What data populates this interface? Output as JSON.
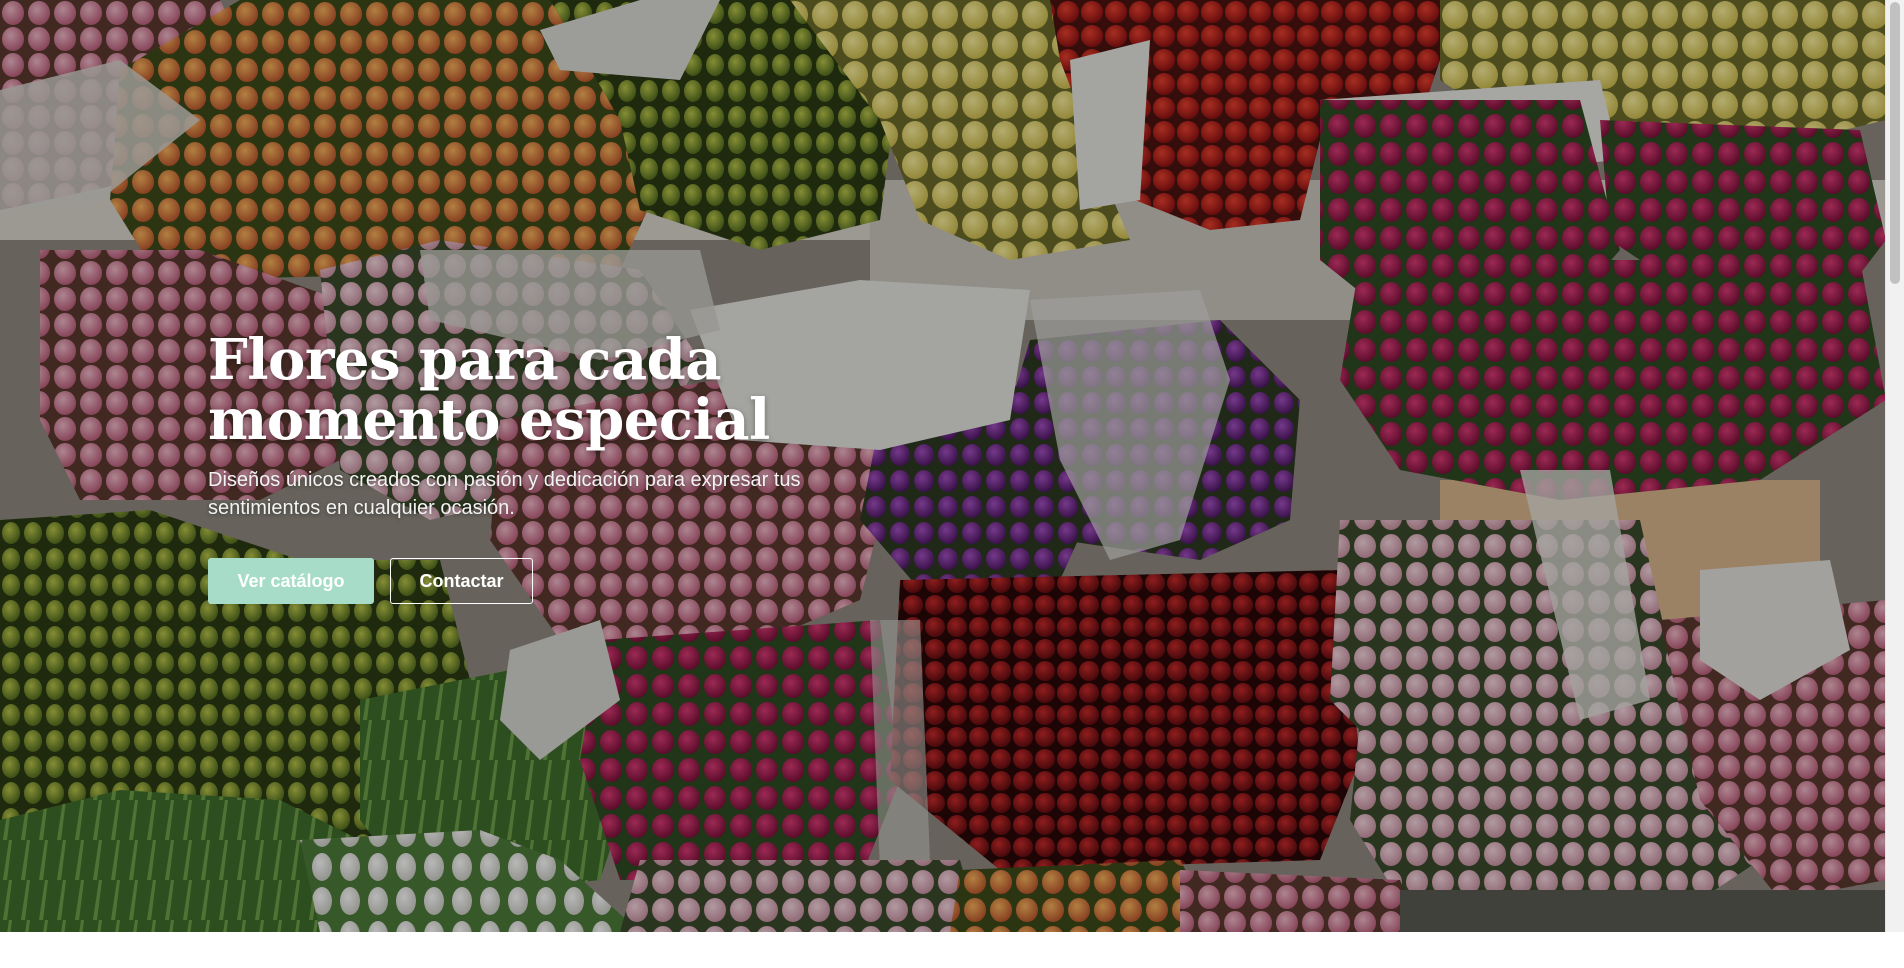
{
  "hero": {
    "title_line1": "Flores para cada",
    "title_line2": "momento especial",
    "subtitle": "Diseños únicos creados con pasión y dedicación para expresar tus sentimientos en cualquier ocasión.",
    "primary_button": "Ver catálogo",
    "secondary_button": "Contactar",
    "background_image": "tulip-bouquets-market-photo"
  },
  "colors": {
    "accent": "#a6dcc8",
    "text_light": "#ffffff"
  }
}
